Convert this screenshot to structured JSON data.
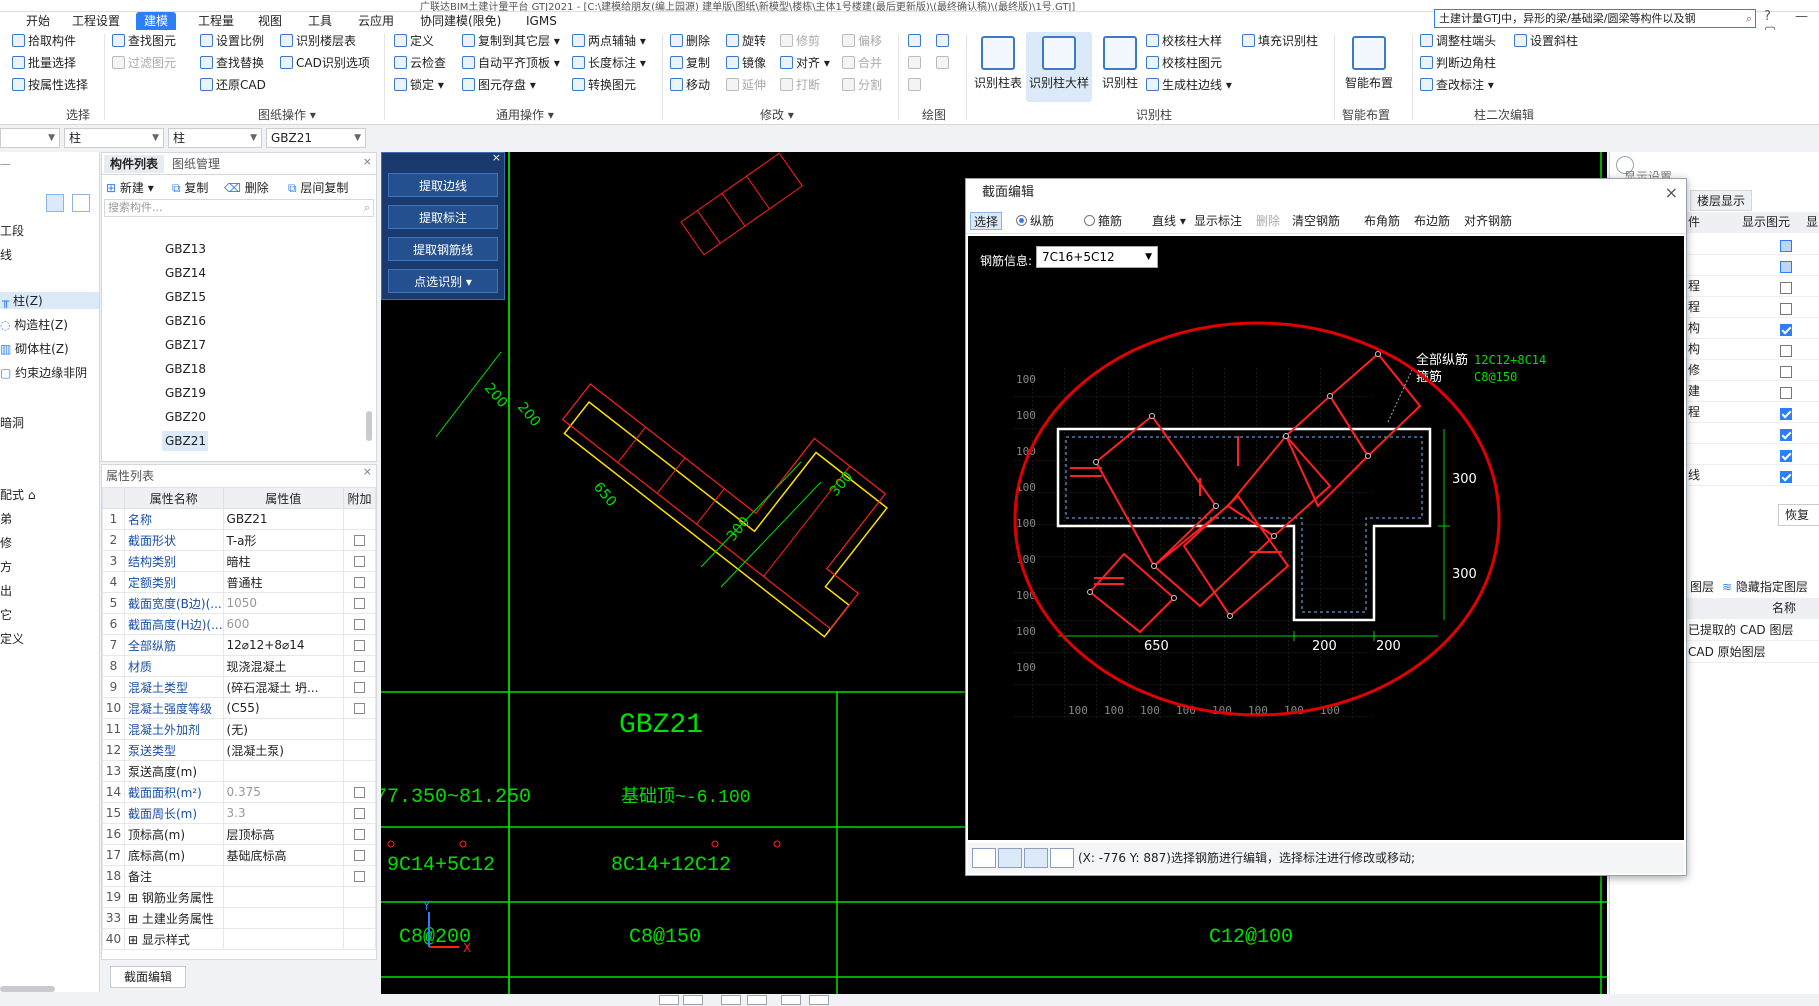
{
  "title_bar": {
    "text": "广联达BIM土建计量平台 GTJ2021 - [C:\\建模给朋友(编上园源) 建单版\\图纸\\新模型\\楼栋\\主体1号楼建(最后更新版)\\(最终确认稿)\\(最终版)\\1号.GTJ]"
  },
  "menu": {
    "tabs": [
      "开始",
      "工程设置",
      "建模",
      "工程量",
      "视图",
      "工具",
      "云应用",
      "协同建模(限免)",
      "IGMS"
    ],
    "active_index": 2
  },
  "search": {
    "placeholder": "土建计量GTJ中，异形的梁/基础梁/圆梁等构件以及钢"
  },
  "window_controls": "? — ▢",
  "ribbon": {
    "select": {
      "items": [
        "拾取构件",
        "批量选择",
        "按属性选择"
      ],
      "group_label": "选择"
    },
    "drawing_ops": {
      "items": [
        "查找图元",
        "过滤图元",
        "设置比例",
        "查找替换",
        "还原CAD",
        "识别楼层表",
        "CAD识别选项"
      ],
      "group_label": "图纸操作 ▾"
    },
    "common_ops": {
      "items": [
        "定义",
        "云检查",
        "锁定 ▾",
        "复制到其它层 ▾",
        "自动平齐顶板 ▾",
        "图元存盘 ▾",
        "两点辅轴 ▾",
        "长度标注 ▾",
        "转换图元"
      ],
      "group_label": "通用操作 ▾"
    },
    "modify": {
      "items": [
        "删除",
        "复制",
        "移动",
        "旋转",
        "镜像",
        "延伸",
        "修剪",
        "对齐 ▾",
        "打断",
        "偏移",
        "合并",
        "分割"
      ],
      "group_label": "修改 ▾"
    },
    "draw": {
      "group_label": "绘图"
    },
    "recognize_column": {
      "big": [
        "识别柱表",
        "识别柱大样",
        "识别柱"
      ],
      "items": [
        "校核柱大样",
        "校核柱图元",
        "生成柱边线 ▾",
        "填充识别柱"
      ],
      "group_label": "识别柱"
    },
    "smart": {
      "big": "智能布置",
      "group_label": "智能布置"
    },
    "column_secondary": {
      "items": [
        "调整柱端头",
        "判断边角柱",
        "查改标注 ▾",
        "设置斜柱"
      ],
      "group_label": "柱二次编辑"
    }
  },
  "combos": [
    "",
    "柱",
    "柱",
    "GBZ21"
  ],
  "left_nav": {
    "items": [
      "工段",
      "线",
      "柱(Z)",
      "构造柱(Z)",
      "砌体柱(Z)",
      "约束边缘非阴",
      "暗洞",
      "配式 ⌂",
      "弟",
      "修",
      "方",
      "出",
      "它",
      "定义"
    ],
    "selected_index": 2
  },
  "component_panel": {
    "tabs": [
      "构件列表",
      "图纸管理"
    ],
    "toolbar": [
      "新建 ▾",
      "复制",
      "删除",
      "层间复制"
    ],
    "search_placeholder": "搜索构件...",
    "items": [
      "GBZ13",
      "GBZ14",
      "GBZ15",
      "GBZ16",
      "GBZ17",
      "GBZ18",
      "GBZ19",
      "GBZ20",
      "GBZ21"
    ],
    "selected": "GBZ21"
  },
  "property_panel": {
    "title": "属性列表",
    "headers": [
      "",
      "属性名称",
      "属性值",
      "附加"
    ],
    "rows": [
      {
        "num": "1",
        "name": "名称",
        "value": "GBZ21",
        "blue": true,
        "check": false,
        "grey": false
      },
      {
        "num": "2",
        "name": "截面形状",
        "value": "T-a形",
        "blue": true,
        "check": true,
        "grey": false
      },
      {
        "num": "3",
        "name": "结构类别",
        "value": "暗柱",
        "blue": true,
        "check": true,
        "grey": false
      },
      {
        "num": "4",
        "name": "定额类别",
        "value": "普通柱",
        "blue": true,
        "check": true,
        "grey": false
      },
      {
        "num": "5",
        "name": "截面宽度(B边)(...",
        "value": "1050",
        "blue": true,
        "check": true,
        "grey": true
      },
      {
        "num": "6",
        "name": "截面高度(H边)(...",
        "value": "600",
        "blue": true,
        "check": true,
        "grey": true
      },
      {
        "num": "7",
        "name": "全部纵筋",
        "value": "12⌀12+8⌀14",
        "blue": true,
        "check": true,
        "grey": false
      },
      {
        "num": "8",
        "name": "材质",
        "value": "现浇混凝土",
        "blue": true,
        "check": true,
        "grey": false
      },
      {
        "num": "9",
        "name": "混凝土类型",
        "value": "(碎石混凝土 坍...",
        "blue": true,
        "check": true,
        "grey": false
      },
      {
        "num": "10",
        "name": "混凝土强度等级",
        "value": "(C55)",
        "blue": true,
        "check": true,
        "grey": false
      },
      {
        "num": "11",
        "name": "混凝土外加剂",
        "value": "(无)",
        "blue": true,
        "check": false,
        "grey": false
      },
      {
        "num": "12",
        "name": "泵送类型",
        "value": "(混凝土泵)",
        "blue": true,
        "check": false,
        "grey": false
      },
      {
        "num": "13",
        "name": "泵送高度(m)",
        "value": "",
        "blue": false,
        "check": false,
        "grey": false
      },
      {
        "num": "14",
        "name": "截面面积(m²)",
        "value": "0.375",
        "blue": true,
        "check": true,
        "grey": true
      },
      {
        "num": "15",
        "name": "截面周长(m)",
        "value": "3.3",
        "blue": true,
        "check": true,
        "grey": true
      },
      {
        "num": "16",
        "name": "顶标高(m)",
        "value": "层顶标高",
        "blue": false,
        "check": true,
        "grey": false
      },
      {
        "num": "17",
        "name": "底标高(m)",
        "value": "基础底标高",
        "blue": false,
        "check": true,
        "grey": false
      },
      {
        "num": "18",
        "name": "备注",
        "value": "",
        "blue": false,
        "check": true,
        "grey": false
      },
      {
        "num": "19",
        "name": "⊞ 钢筋业务属性",
        "value": "",
        "blue": false,
        "check": false,
        "grey": false
      },
      {
        "num": "33",
        "name": "⊞ 土建业务属性",
        "value": "",
        "blue": false,
        "check": false,
        "grey": false
      },
      {
        "num": "40",
        "name": "⊞ 显示样式",
        "value": "",
        "blue": false,
        "check": false,
        "grey": false
      }
    ]
  },
  "section_edit_tab": "截面编辑",
  "extract_panel": {
    "buttons": [
      "提取边线",
      "提取标注",
      "提取钢筋线",
      "点选识别 ▾"
    ]
  },
  "cad": {
    "dims": [
      "200",
      "200",
      "650",
      "300",
      "300"
    ],
    "column_name": "GBZ21",
    "elev_left": "77.350~81.250",
    "elev_mid": "基础顶~-6.100",
    "rebar_left": "9C14+5C12",
    "rebar_mid": "8C14+12C12",
    "stir_left": "C8@200",
    "stir_mid": "C8@150",
    "stir_right": "C12@100",
    "axis_y": "Y",
    "axis_x": "X"
  },
  "dialog": {
    "title": "截面编辑",
    "tools": [
      "选择",
      "纵筋",
      "箍筋",
      "直线 ▾",
      "显示标注",
      "删除",
      "清空钢筋",
      "布角筋",
      "布边筋",
      "对齐钢筋"
    ],
    "rebar_info_label": "钢筋信息:",
    "rebar_info_value": "7C16+5C12",
    "legend_total_label": "全部纵筋",
    "legend_total_value": "12C12+8C14",
    "legend_stir_label": "箍筋",
    "legend_stir_value": "C8@150",
    "grid_label": "100",
    "dims": {
      "d300a": "300",
      "d300b": "300",
      "d650": "650",
      "d200a": "200",
      "d200b": "200"
    },
    "status": "(X: -776 Y: 887)选择钢筋进行编辑，选择标注进行修改或移动;"
  },
  "right_panel": {
    "title": "显示设置",
    "tab": "楼层显示",
    "headers": [
      "件",
      "显示图元",
      "显"
    ],
    "rows": [
      {
        "label": "",
        "state": "part"
      },
      {
        "label": "",
        "state": "part"
      },
      {
        "label": "程",
        "state": "off"
      },
      {
        "label": "程",
        "state": "off"
      },
      {
        "label": "构",
        "state": "on"
      },
      {
        "label": "构",
        "state": "off"
      },
      {
        "label": "修",
        "state": "off"
      },
      {
        "label": "建",
        "state": "off"
      },
      {
        "label": "程",
        "state": "on"
      },
      {
        "label": "",
        "state": "on"
      },
      {
        "label": "",
        "state": "on"
      },
      {
        "label": "线",
        "state": "on"
      }
    ],
    "restore": "恢复",
    "layer_tabs": [
      "图层",
      "隐藏指定图层"
    ],
    "layer_header": "名称",
    "layers": [
      "已提取的 CAD 图层",
      "CAD 原始图层"
    ]
  },
  "colors": {
    "accent": "#2d7ff9",
    "cad_green": "#00e000",
    "cad_red": "#ff1f1f",
    "cad_yellow": "#ffe000",
    "highlight_red": "#e00000"
  }
}
